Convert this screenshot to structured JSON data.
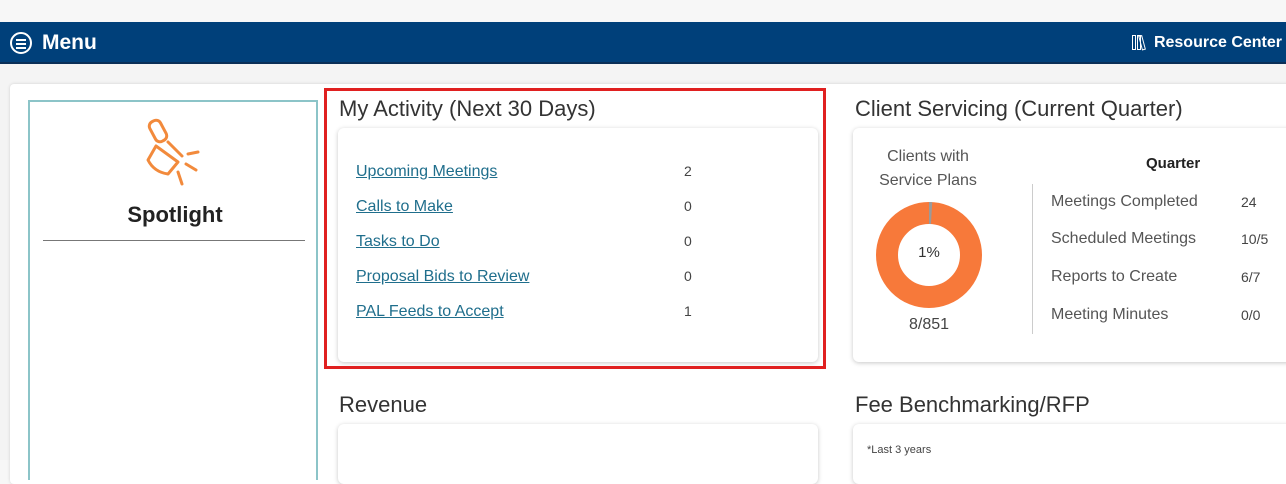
{
  "navbar": {
    "menu_label": "Menu",
    "menu_icon": "hamburger-circle-icon",
    "resource_label": "Resource Center",
    "resource_icon": "books-icon",
    "bg_color": "#00407a"
  },
  "spotlight": {
    "title": "Spotlight",
    "icon": "spotlight-lamp-icon",
    "icon_color": "#f28a3c"
  },
  "my_activity": {
    "title": "My Activity (Next 30 Days)",
    "items": [
      {
        "label": "Upcoming Meetings",
        "count": "2"
      },
      {
        "label": "Calls to Make",
        "count": "0"
      },
      {
        "label": "Tasks to Do",
        "count": "0"
      },
      {
        "label": "Proposal Bids to Review",
        "count": "0"
      },
      {
        "label": "PAL Feeds to Accept",
        "count": "1"
      }
    ],
    "highlight_color": "#e02020"
  },
  "client_servicing": {
    "title": "Client Servicing (Current Quarter)",
    "subtitle_line1": "Clients with",
    "subtitle_line2": "Service Plans",
    "percent_label": "1%",
    "percent_value": 0.01,
    "count_label": "8/851",
    "quarter_header": "Quarter",
    "quarter_rows": [
      {
        "label": "Meetings Completed",
        "value": "24"
      },
      {
        "label": "Scheduled Meetings",
        "value": "10/5"
      },
      {
        "label": "Reports to Create",
        "value": "6/7"
      },
      {
        "label": "Meeting Minutes",
        "value": "0/0"
      }
    ],
    "donut_color": "#f7793a"
  },
  "revenue": {
    "title": "Revenue"
  },
  "fee_benchmarking": {
    "title": "Fee Benchmarking/RFP",
    "note": "*Last 3 years"
  }
}
